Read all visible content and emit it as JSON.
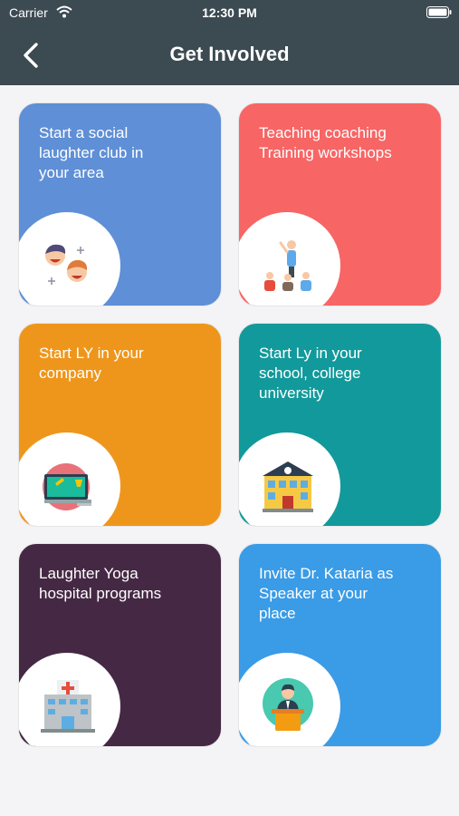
{
  "status_bar": {
    "carrier": "Carrier",
    "time": "12:30 PM"
  },
  "nav": {
    "title": "Get Involved",
    "back_icon": "chevron-left-icon"
  },
  "cards": [
    {
      "title": "Start a social\nlaughter club in\nyour area",
      "color": "#5f8fd6",
      "icon": "laughing-faces-icon"
    },
    {
      "title": "Teaching coaching\nTraining workshops",
      "color": "#f76565",
      "icon": "trainer-audience-icon"
    },
    {
      "title": "Start LY in your\ncompany",
      "color": "#ee961c",
      "icon": "office-desk-icon"
    },
    {
      "title": "Start Ly in your\nschool, college\nuniversity",
      "color": "#12999b",
      "icon": "school-building-icon"
    },
    {
      "title": "Laughter Yoga\nhospital programs",
      "color": "#452944",
      "icon": "hospital-icon"
    },
    {
      "title": "Invite Dr. Kataria as\nSpeaker at your\nplace",
      "color": "#3a9be6",
      "icon": "speaker-podium-icon"
    }
  ]
}
